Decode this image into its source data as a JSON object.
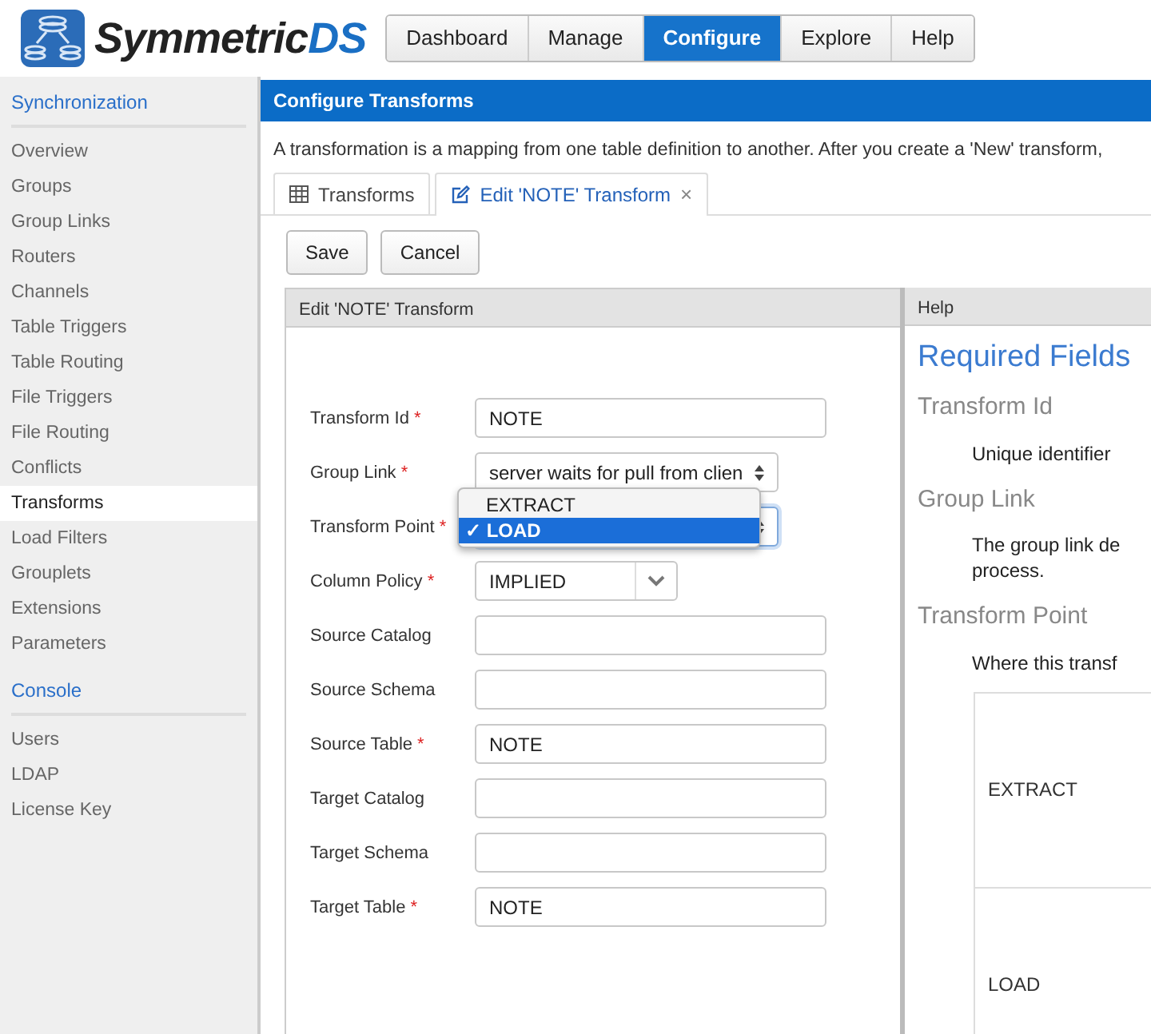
{
  "header": {
    "logo_parts": [
      "Symmetric",
      "DS"
    ],
    "nav": [
      {
        "label": "Dashboard",
        "selected": false
      },
      {
        "label": "Manage",
        "selected": false
      },
      {
        "label": "Configure",
        "selected": true
      },
      {
        "label": "Explore",
        "selected": false
      },
      {
        "label": "Help",
        "selected": false
      }
    ]
  },
  "sidebar": {
    "sections": [
      {
        "title": "Synchronization",
        "items": [
          {
            "label": "Overview",
            "selected": false
          },
          {
            "label": "Groups",
            "selected": false
          },
          {
            "label": "Group Links",
            "selected": false
          },
          {
            "label": "Routers",
            "selected": false
          },
          {
            "label": "Channels",
            "selected": false
          },
          {
            "label": "Table Triggers",
            "selected": false
          },
          {
            "label": "Table Routing",
            "selected": false
          },
          {
            "label": "File Triggers",
            "selected": false
          },
          {
            "label": "File Routing",
            "selected": false
          },
          {
            "label": "Conflicts",
            "selected": false
          },
          {
            "label": "Transforms",
            "selected": true
          },
          {
            "label": "Load Filters",
            "selected": false
          },
          {
            "label": "Grouplets",
            "selected": false
          },
          {
            "label": "Extensions",
            "selected": false
          },
          {
            "label": "Parameters",
            "selected": false
          }
        ]
      },
      {
        "title": "Console",
        "items": [
          {
            "label": "Users",
            "selected": false
          },
          {
            "label": "LDAP",
            "selected": false
          },
          {
            "label": "License Key",
            "selected": false
          }
        ]
      }
    ]
  },
  "page": {
    "title": "Configure Transforms",
    "description": "A transformation is a mapping from one table definition to another. After you create a 'New' transform,",
    "tabs": [
      {
        "label": "Transforms",
        "selected": false,
        "closable": false
      },
      {
        "label": "Edit 'NOTE' Transform",
        "selected": true,
        "closable": true
      }
    ],
    "close_glyph": "×",
    "buttons": [
      "Save",
      "Cancel"
    ]
  },
  "form": {
    "title": "Edit 'NOTE' Transform",
    "required_mark": "*",
    "check_glyph": "✓",
    "fields": [
      {
        "label": "Transform Id",
        "required": true,
        "kind": "text",
        "value": "NOTE"
      },
      {
        "label": "Group Link",
        "required": true,
        "kind": "select",
        "value": "server waits for pull from clien"
      },
      {
        "label": "Transform Point",
        "required": true,
        "kind": "select",
        "options": [
          {
            "label": "EXTRACT",
            "selected": false
          },
          {
            "label": "LOAD",
            "selected": true
          }
        ]
      },
      {
        "label": "Column Policy",
        "required": true,
        "kind": "combo",
        "value": "IMPLIED"
      },
      {
        "label": "Source Catalog",
        "required": false,
        "kind": "text"
      },
      {
        "label": "Source Schema",
        "required": false,
        "kind": "text"
      },
      {
        "label": "Source Table",
        "required": true,
        "kind": "text",
        "value": "NOTE"
      },
      {
        "label": "Target Catalog",
        "required": false,
        "kind": "text"
      },
      {
        "label": "Target Schema",
        "required": false,
        "kind": "text"
      },
      {
        "label": "Target Table",
        "required": true,
        "kind": "text",
        "value": "NOTE"
      }
    ]
  },
  "help": {
    "title": "Help",
    "heading": "Required Fields",
    "entries": [
      {
        "term": "Transform Id",
        "description": "Unique identifier"
      },
      {
        "term": "Group Link",
        "description_lines": [
          "The group link de",
          "process."
        ]
      },
      {
        "term": "Transform Point",
        "description": "Where this transf",
        "table_rows": [
          "EXTRACT",
          "LOAD"
        ]
      }
    ]
  }
}
